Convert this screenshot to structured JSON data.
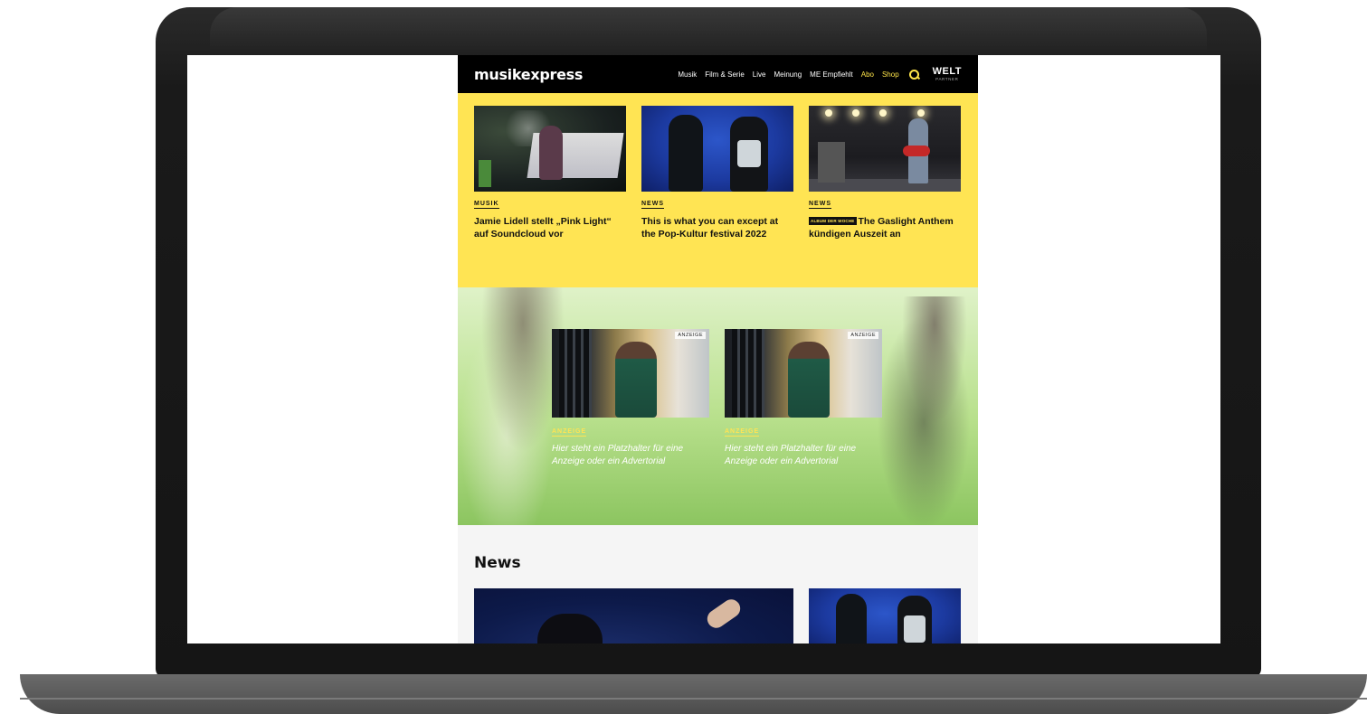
{
  "header": {
    "logo": "musikexpress",
    "nav": [
      {
        "label": "Musik",
        "accent": false
      },
      {
        "label": "Film & Serie",
        "accent": false
      },
      {
        "label": "Live",
        "accent": false
      },
      {
        "label": "Meinung",
        "accent": false
      },
      {
        "label": "ME Empfiehlt",
        "accent": false
      },
      {
        "label": "Abo",
        "accent": true
      },
      {
        "label": "Shop",
        "accent": true
      }
    ],
    "partner_logo": "WELT",
    "partner_sub": "PARTNER",
    "search_icon": "search-icon"
  },
  "teasers": [
    {
      "category": "MUSIK",
      "badge": "",
      "headline": "Jamie Lidell stellt „Pink Light“ auf Soundcloud vor"
    },
    {
      "category": "NEWS",
      "badge": "",
      "headline": "This is what you can except at the Pop-Kultur festival 2022"
    },
    {
      "category": "NEWS",
      "badge": "ALBUM DER WOCHE",
      "headline": "The Gaslight Anthem kündigen Auszeit an"
    }
  ],
  "ads": [
    {
      "label": "ANZEIGE",
      "category": "ANZEIGE",
      "text": "Hier steht ein Platzhalter für eine Anzeige oder ein Advertorial"
    },
    {
      "label": "ANZEIGE",
      "category": "ANZEIGE",
      "text": "Hier steht ein Platzhalter für eine Anzeige oder ein Advertorial"
    }
  ],
  "news": {
    "title": "News"
  },
  "colors": {
    "accent_yellow": "#ffe453",
    "header_black": "#000000",
    "ad_green": "#b8e08c"
  }
}
